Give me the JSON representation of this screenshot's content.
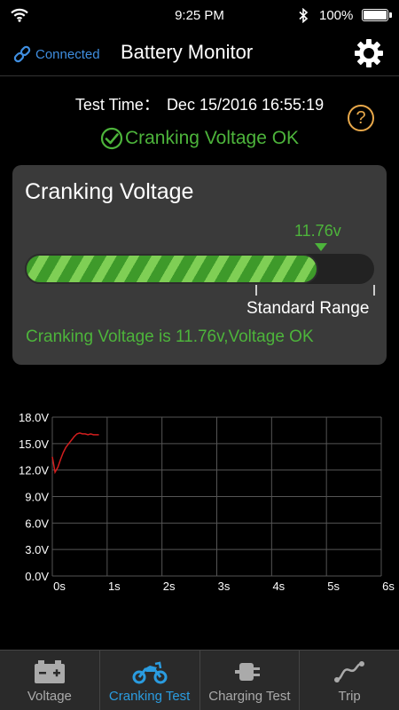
{
  "status_bar": {
    "time": "9:25 PM",
    "battery_percent": "100%"
  },
  "nav": {
    "connection_label": "Connected",
    "title": "Battery Monitor"
  },
  "test": {
    "time_label": "Test Time：",
    "time_value": "Dec 15/2016 16:55:19",
    "help_glyph": "?",
    "status_text": "Cranking Voltage OK"
  },
  "card": {
    "title": "Cranking Voltage",
    "value_label": "11.76v",
    "fill_fraction": 0.84,
    "range_label": "Standard Range",
    "description": "Cranking Voltage is 11.76v,Voltage OK"
  },
  "colors": {
    "ok_green": "#4db43b",
    "accent_blue": "#2a9ce0",
    "link_blue": "#3f8ee0",
    "help_orange": "#e8a84a",
    "trace_red": "#d21e1e"
  },
  "chart_data": {
    "type": "line",
    "x_ticks": [
      "0s",
      "1s",
      "2s",
      "3s",
      "4s",
      "5s",
      "6s"
    ],
    "y_ticks": [
      "0.0V",
      "3.0V",
      "6.0V",
      "9.0V",
      "12.0V",
      "15.0V",
      "18.0V"
    ],
    "xlim": [
      0,
      6
    ],
    "ylim": [
      0,
      18
    ],
    "grid": true,
    "series": [
      {
        "x": [
          0,
          0.05,
          0.1,
          0.15,
          0.2,
          0.25,
          0.3,
          0.35,
          0.4,
          0.45,
          0.5,
          0.55,
          0.6,
          0.65,
          0.7,
          0.75,
          0.8,
          0.85
        ],
        "y": [
          13.5,
          11.76,
          12.3,
          13.2,
          14.0,
          14.6,
          15.0,
          15.4,
          15.8,
          16.1,
          16.2,
          16.1,
          16.1,
          16.0,
          16.1,
          16.0,
          16.0,
          16.0
        ]
      }
    ]
  },
  "tabs": [
    {
      "label": "Voltage",
      "icon": "battery-icon",
      "active": false
    },
    {
      "label": "Cranking Test",
      "icon": "motorcycle-icon",
      "active": true
    },
    {
      "label": "Charging Test",
      "icon": "plug-icon",
      "active": false
    },
    {
      "label": "Trip",
      "icon": "route-icon",
      "active": false
    }
  ]
}
